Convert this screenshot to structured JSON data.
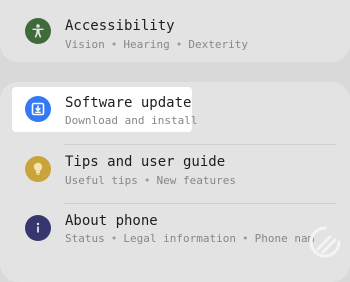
{
  "colors": {
    "accessibility_icon": "#3f6b3a",
    "software_update_icon": "#3478f6",
    "tips_icon": "#c9a43a",
    "about_icon": "#36376e",
    "highlight": "#ffffff",
    "background": "#d9d9d9"
  },
  "settings": {
    "accessibility": {
      "icon": "accessibility-person-icon",
      "title": "Accessibility",
      "subtitle": [
        "Vision",
        "Hearing",
        "Dexterity"
      ]
    },
    "software_update": {
      "icon": "download-box-icon",
      "title": "Software update",
      "subtitle": [
        "Download and install"
      ]
    },
    "tips": {
      "icon": "lightbulb-icon",
      "title": "Tips and user guide",
      "subtitle": [
        "Useful tips",
        "New features"
      ]
    },
    "about_phone": {
      "icon": "info-icon",
      "title": "About phone",
      "subtitle": [
        "Status",
        "Legal information",
        "Phone nam"
      ]
    }
  },
  "separator": "•"
}
